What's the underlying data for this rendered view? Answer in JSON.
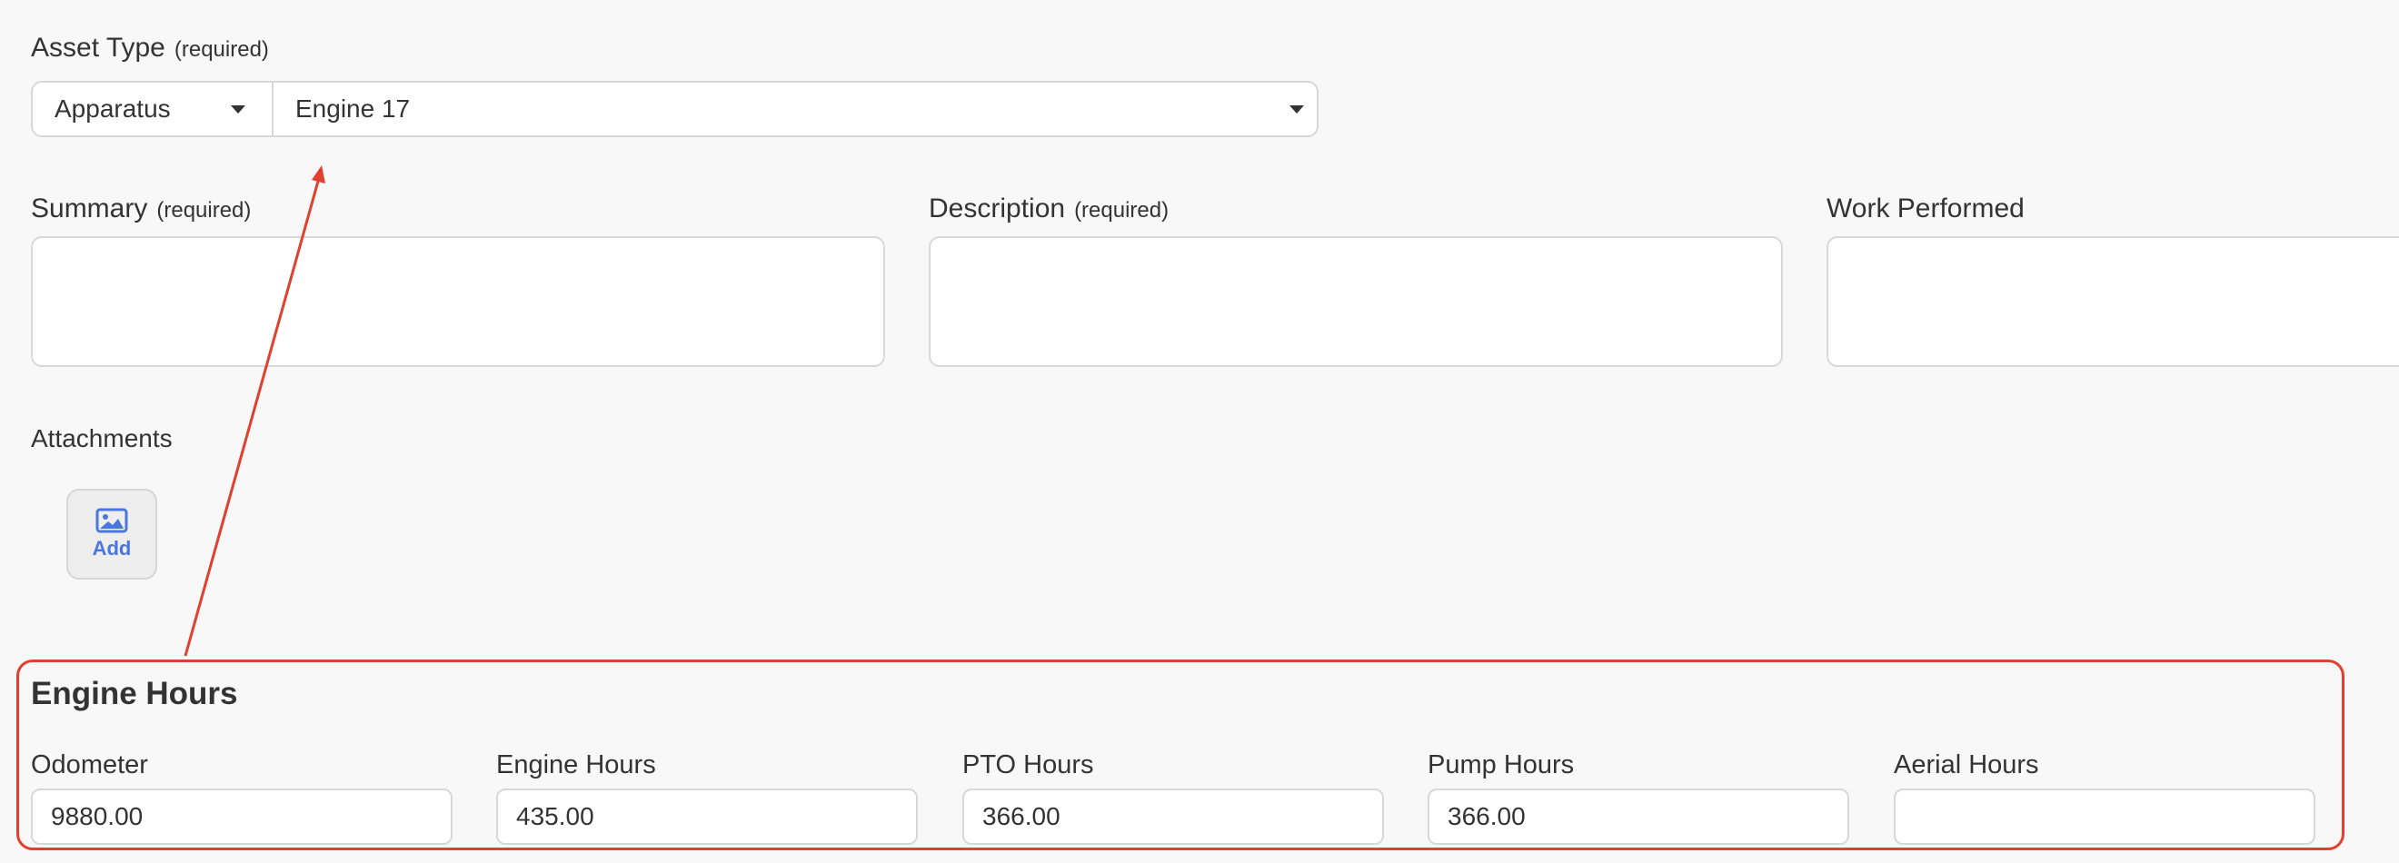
{
  "asset": {
    "label": "Asset Type",
    "required_note": "(required)",
    "type_value": "Apparatus",
    "asset_value": "Engine 17"
  },
  "fields": {
    "summary_label": "Summary",
    "summary_required": "(required)",
    "description_label": "Description",
    "description_required": "(required)",
    "work_label": "Work Performed"
  },
  "attachments": {
    "label": "Attachments",
    "add_label": "Add"
  },
  "engine_hours": {
    "title": "Engine Hours",
    "odometer_label": "Odometer",
    "odometer_value": "9880.00",
    "engine_hours_label": "Engine Hours",
    "engine_hours_value": "435.00",
    "pto_label": "PTO Hours",
    "pto_value": "366.00",
    "pump_label": "Pump Hours",
    "pump_value": "366.00",
    "aerial_label": "Aerial Hours",
    "aerial_value": ""
  },
  "colors": {
    "accent": "#4a76e0",
    "annotation": "#e0402e"
  },
  "icons": {
    "dropdown": "chevron-down-icon",
    "add_image": "image-icon"
  }
}
